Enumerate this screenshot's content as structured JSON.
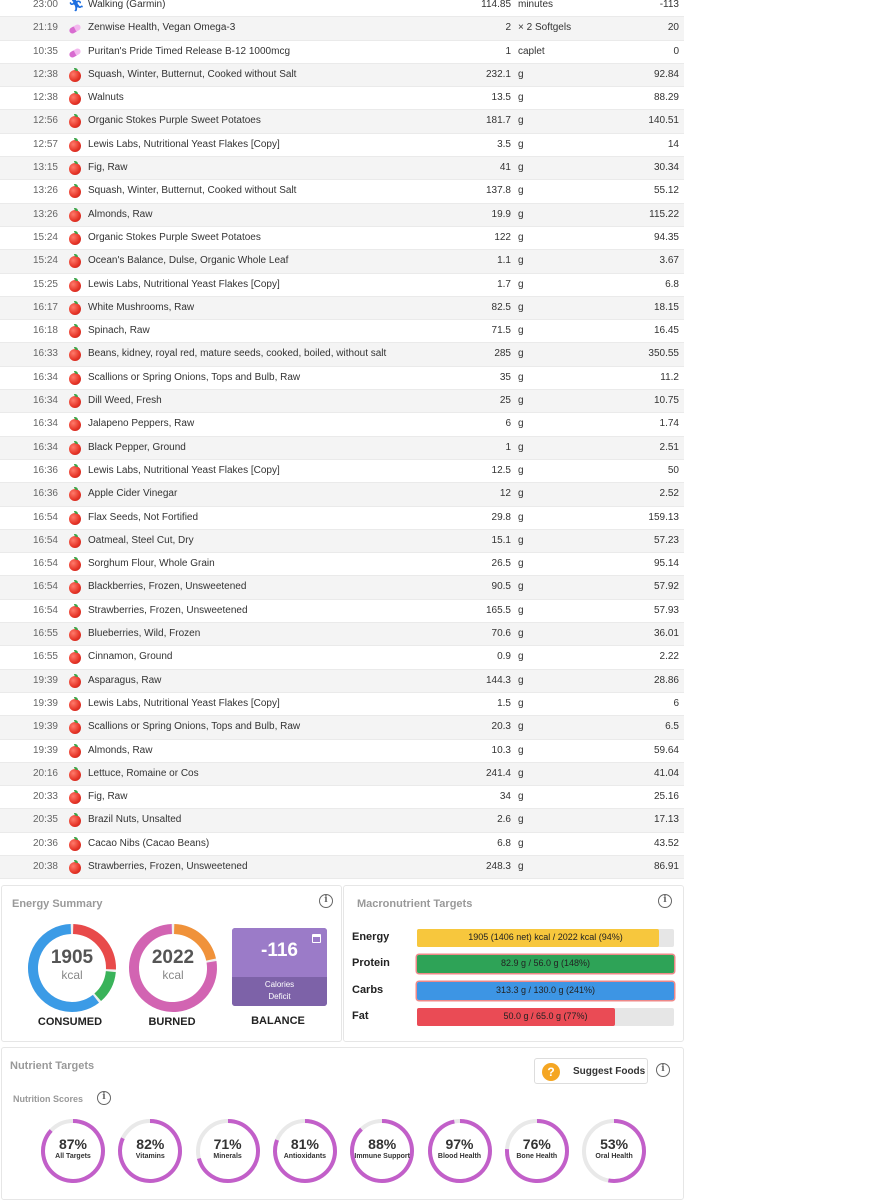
{
  "diary": [
    {
      "time": "23:00",
      "icon": "exercise-icon",
      "name": "Walking (Garmin)",
      "amount": "114.85",
      "unit": "minutes",
      "kcal": "-113"
    },
    {
      "time": "21:19",
      "icon": "supplement-icon",
      "name": "Zenwise Health, Vegan Omega-3",
      "amount": "2",
      "unit": "× 2 Softgels",
      "kcal": "20"
    },
    {
      "time": "10:35",
      "icon": "supplement-icon",
      "name": "Puritan's Pride Timed Release B-12 1000mcg",
      "amount": "1",
      "unit": "caplet",
      "kcal": "0"
    },
    {
      "time": "12:38",
      "icon": "food-icon",
      "name": "Squash, Winter, Butternut, Cooked without Salt",
      "amount": "232.1",
      "unit": "g",
      "kcal": "92.84"
    },
    {
      "time": "12:38",
      "icon": "food-icon",
      "name": "Walnuts",
      "amount": "13.5",
      "unit": "g",
      "kcal": "88.29"
    },
    {
      "time": "12:56",
      "icon": "food-icon",
      "name": "Organic Stokes Purple Sweet Potatoes",
      "amount": "181.7",
      "unit": "g",
      "kcal": "140.51"
    },
    {
      "time": "12:57",
      "icon": "food-icon",
      "name": "Lewis Labs, Nutritional Yeast Flakes [Copy]",
      "amount": "3.5",
      "unit": "g",
      "kcal": "14"
    },
    {
      "time": "13:15",
      "icon": "food-icon",
      "name": "Fig, Raw",
      "amount": "41",
      "unit": "g",
      "kcal": "30.34"
    },
    {
      "time": "13:26",
      "icon": "food-icon",
      "name": "Squash, Winter, Butternut, Cooked without Salt",
      "amount": "137.8",
      "unit": "g",
      "kcal": "55.12"
    },
    {
      "time": "13:26",
      "icon": "food-icon",
      "name": "Almonds, Raw",
      "amount": "19.9",
      "unit": "g",
      "kcal": "115.22"
    },
    {
      "time": "15:24",
      "icon": "food-icon",
      "name": "Organic Stokes Purple Sweet Potatoes",
      "amount": "122",
      "unit": "g",
      "kcal": "94.35"
    },
    {
      "time": "15:24",
      "icon": "food-icon",
      "name": "Ocean's Balance, Dulse, Organic Whole Leaf",
      "amount": "1.1",
      "unit": "g",
      "kcal": "3.67"
    },
    {
      "time": "15:25",
      "icon": "food-icon",
      "name": "Lewis Labs, Nutritional Yeast Flakes [Copy]",
      "amount": "1.7",
      "unit": "g",
      "kcal": "6.8"
    },
    {
      "time": "16:17",
      "icon": "food-icon",
      "name": "White Mushrooms, Raw",
      "amount": "82.5",
      "unit": "g",
      "kcal": "18.15"
    },
    {
      "time": "16:18",
      "icon": "food-icon",
      "name": "Spinach, Raw",
      "amount": "71.5",
      "unit": "g",
      "kcal": "16.45"
    },
    {
      "time": "16:33",
      "icon": "food-icon",
      "name": "Beans, kidney, royal red, mature seeds, cooked, boiled, without salt",
      "amount": "285",
      "unit": "g",
      "kcal": "350.55"
    },
    {
      "time": "16:34",
      "icon": "food-icon",
      "name": "Scallions or Spring Onions, Tops and Bulb, Raw",
      "amount": "35",
      "unit": "g",
      "kcal": "11.2"
    },
    {
      "time": "16:34",
      "icon": "food-icon",
      "name": "Dill Weed, Fresh",
      "amount": "25",
      "unit": "g",
      "kcal": "10.75"
    },
    {
      "time": "16:34",
      "icon": "food-icon",
      "name": "Jalapeno Peppers, Raw",
      "amount": "6",
      "unit": "g",
      "kcal": "1.74"
    },
    {
      "time": "16:34",
      "icon": "food-icon",
      "name": "Black Pepper, Ground",
      "amount": "1",
      "unit": "g",
      "kcal": "2.51"
    },
    {
      "time": "16:36",
      "icon": "food-icon",
      "name": "Lewis Labs, Nutritional Yeast Flakes [Copy]",
      "amount": "12.5",
      "unit": "g",
      "kcal": "50"
    },
    {
      "time": "16:36",
      "icon": "food-icon",
      "name": "Apple Cider Vinegar",
      "amount": "12",
      "unit": "g",
      "kcal": "2.52"
    },
    {
      "time": "16:54",
      "icon": "food-icon",
      "name": "Flax Seeds, Not Fortified",
      "amount": "29.8",
      "unit": "g",
      "kcal": "159.13"
    },
    {
      "time": "16:54",
      "icon": "food-icon",
      "name": "Oatmeal, Steel Cut, Dry",
      "amount": "15.1",
      "unit": "g",
      "kcal": "57.23"
    },
    {
      "time": "16:54",
      "icon": "food-icon",
      "name": "Sorghum Flour, Whole Grain",
      "amount": "26.5",
      "unit": "g",
      "kcal": "95.14"
    },
    {
      "time": "16:54",
      "icon": "food-icon",
      "name": "Blackberries, Frozen, Unsweetened",
      "amount": "90.5",
      "unit": "g",
      "kcal": "57.92"
    },
    {
      "time": "16:54",
      "icon": "food-icon",
      "name": "Strawberries, Frozen, Unsweetened",
      "amount": "165.5",
      "unit": "g",
      "kcal": "57.93"
    },
    {
      "time": "16:55",
      "icon": "food-icon",
      "name": "Blueberries, Wild, Frozen",
      "amount": "70.6",
      "unit": "g",
      "kcal": "36.01"
    },
    {
      "time": "16:55",
      "icon": "food-icon",
      "name": "Cinnamon, Ground",
      "amount": "0.9",
      "unit": "g",
      "kcal": "2.22"
    },
    {
      "time": "19:39",
      "icon": "food-icon",
      "name": "Asparagus, Raw",
      "amount": "144.3",
      "unit": "g",
      "kcal": "28.86"
    },
    {
      "time": "19:39",
      "icon": "food-icon",
      "name": "Lewis Labs, Nutritional Yeast Flakes [Copy]",
      "amount": "1.5",
      "unit": "g",
      "kcal": "6"
    },
    {
      "time": "19:39",
      "icon": "food-icon",
      "name": "Scallions or Spring Onions, Tops and Bulb, Raw",
      "amount": "20.3",
      "unit": "g",
      "kcal": "6.5"
    },
    {
      "time": "19:39",
      "icon": "food-icon",
      "name": "Almonds, Raw",
      "amount": "10.3",
      "unit": "g",
      "kcal": "59.64"
    },
    {
      "time": "20:16",
      "icon": "food-icon",
      "name": "Lettuce, Romaine or Cos",
      "amount": "241.4",
      "unit": "g",
      "kcal": "41.04"
    },
    {
      "time": "20:33",
      "icon": "food-icon",
      "name": "Fig, Raw",
      "amount": "34",
      "unit": "g",
      "kcal": "25.16"
    },
    {
      "time": "20:35",
      "icon": "food-icon",
      "name": "Brazil Nuts, Unsalted",
      "amount": "2.6",
      "unit": "g",
      "kcal": "17.13"
    },
    {
      "time": "20:36",
      "icon": "food-icon",
      "name": "Cacao Nibs (Cacao Beans)",
      "amount": "6.8",
      "unit": "g",
      "kcal": "43.52"
    },
    {
      "time": "20:38",
      "icon": "food-icon",
      "name": "Strawberries, Frozen, Unsweetened",
      "amount": "248.3",
      "unit": "g",
      "kcal": "86.91"
    }
  ],
  "energy_summary": {
    "title": "Energy Summary",
    "consumed": {
      "value": "1905",
      "unit": "kcal",
      "label": "CONSUMED"
    },
    "burned": {
      "value": "2022",
      "unit": "kcal",
      "label": "BURNED"
    },
    "balance": {
      "value": "-116",
      "line1": "Calories",
      "line2": "Deficit",
      "label": "BALANCE"
    },
    "colors": {
      "consumed_blue": "#3b9be6",
      "consumed_green": "#3ab35a",
      "consumed_red": "#e84a4a",
      "burned_pink": "#d264b2",
      "burned_orange": "#f0923a",
      "balance_purple": "#9b7bc8"
    }
  },
  "macros": {
    "title": "Macronutrient Targets",
    "rows": [
      {
        "label": "Energy",
        "text": "1905 (1406 net) kcal / 2022 kcal (94%)",
        "fraction": 0.94,
        "color": "#f7c73d",
        "over": false
      },
      {
        "label": "Protein",
        "text": "82.9 g / 56.0 g (148%)",
        "fraction": 1.0,
        "color": "#2ea357",
        "over": true
      },
      {
        "label": "Carbs",
        "text": "313.3 g / 130.0 g (241%)",
        "fraction": 1.0,
        "color": "#3d95e4",
        "over": true
      },
      {
        "label": "Fat",
        "text": "50.0 g / 65.0 g (77%)",
        "fraction": 0.77,
        "color": "#ea4b55",
        "over": false
      }
    ]
  },
  "nutrients": {
    "title": "Nutrient Targets",
    "suggest_label": "Suggest Foods",
    "scores_title": "Nutrition Scores",
    "ring_color": "#c25fc9",
    "scores": [
      {
        "pct": "87%",
        "value": 0.87,
        "name": "All Targets"
      },
      {
        "pct": "82%",
        "value": 0.82,
        "name": "Vitamins"
      },
      {
        "pct": "71%",
        "value": 0.71,
        "name": "Minerals"
      },
      {
        "pct": "81%",
        "value": 0.81,
        "name": "Antioxidants"
      },
      {
        "pct": "88%",
        "value": 0.88,
        "name": "Immune Support"
      },
      {
        "pct": "97%",
        "value": 0.97,
        "name": "Blood Health"
      },
      {
        "pct": "76%",
        "value": 0.76,
        "name": "Bone Health"
      },
      {
        "pct": "53%",
        "value": 0.53,
        "name": "Oral Health"
      }
    ]
  }
}
